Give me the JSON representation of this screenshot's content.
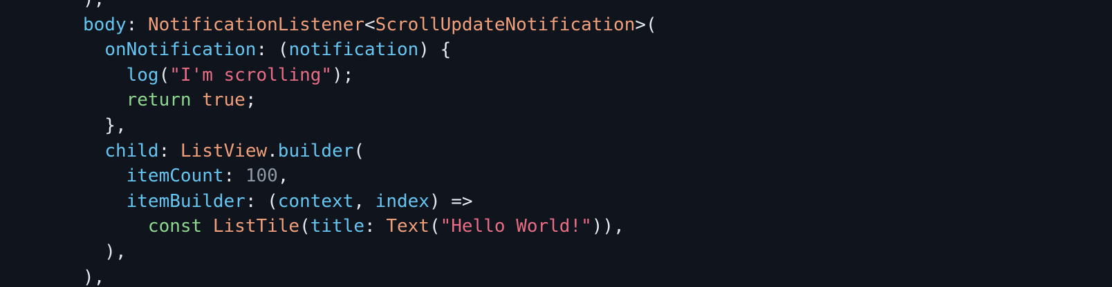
{
  "editor": {
    "background": "#0f141d",
    "colors": {
      "plain": "#e6e9ef",
      "property": "#66c6f1",
      "type": "#f2a07b",
      "string": "#e86d85",
      "keyword": "#8ed88f",
      "number": "#9099a6"
    },
    "lines": [
      [
        {
          "t": "),",
          "k": "plain"
        }
      ],
      [
        {
          "t": "body",
          "k": "prop"
        },
        {
          "t": ": ",
          "k": "plain"
        },
        {
          "t": "NotificationListener",
          "k": "type"
        },
        {
          "t": "<",
          "k": "plain"
        },
        {
          "t": "ScrollUpdateNotification",
          "k": "type"
        },
        {
          "t": ">(",
          "k": "plain"
        }
      ],
      [
        {
          "t": "  ",
          "k": "plain"
        },
        {
          "t": "onNotification",
          "k": "prop"
        },
        {
          "t": ": (",
          "k": "plain"
        },
        {
          "t": "notification",
          "k": "param"
        },
        {
          "t": ") {",
          "k": "plain"
        }
      ],
      [
        {
          "t": "    ",
          "k": "plain"
        },
        {
          "t": "log",
          "k": "func"
        },
        {
          "t": "(",
          "k": "plain"
        },
        {
          "t": "\"I'm scrolling\"",
          "k": "string"
        },
        {
          "t": ");",
          "k": "plain"
        }
      ],
      [
        {
          "t": "    ",
          "k": "plain"
        },
        {
          "t": "return",
          "k": "keyword"
        },
        {
          "t": " ",
          "k": "plain"
        },
        {
          "t": "true",
          "k": "bool"
        },
        {
          "t": ";",
          "k": "plain"
        }
      ],
      [
        {
          "t": "  },",
          "k": "plain"
        }
      ],
      [
        {
          "t": "  ",
          "k": "plain"
        },
        {
          "t": "child",
          "k": "prop"
        },
        {
          "t": ": ",
          "k": "plain"
        },
        {
          "t": "ListView",
          "k": "type"
        },
        {
          "t": ".",
          "k": "plain"
        },
        {
          "t": "builder",
          "k": "func"
        },
        {
          "t": "(",
          "k": "plain"
        }
      ],
      [
        {
          "t": "    ",
          "k": "plain"
        },
        {
          "t": "itemCount",
          "k": "prop"
        },
        {
          "t": ": ",
          "k": "plain"
        },
        {
          "t": "100",
          "k": "number"
        },
        {
          "t": ",",
          "k": "plain"
        }
      ],
      [
        {
          "t": "    ",
          "k": "plain"
        },
        {
          "t": "itemBuilder",
          "k": "prop"
        },
        {
          "t": ": (",
          "k": "plain"
        },
        {
          "t": "context",
          "k": "param"
        },
        {
          "t": ", ",
          "k": "plain"
        },
        {
          "t": "index",
          "k": "param"
        },
        {
          "t": ") =>",
          "k": "plain"
        }
      ],
      [
        {
          "t": "      ",
          "k": "plain"
        },
        {
          "t": "const",
          "k": "keyword"
        },
        {
          "t": " ",
          "k": "plain"
        },
        {
          "t": "ListTile",
          "k": "type"
        },
        {
          "t": "(",
          "k": "plain"
        },
        {
          "t": "title",
          "k": "prop"
        },
        {
          "t": ": ",
          "k": "plain"
        },
        {
          "t": "Text",
          "k": "type"
        },
        {
          "t": "(",
          "k": "plain"
        },
        {
          "t": "\"Hello World!\"",
          "k": "string"
        },
        {
          "t": ")),",
          "k": "plain"
        }
      ],
      [
        {
          "t": "  ),",
          "k": "plain"
        }
      ],
      [
        {
          "t": "),",
          "k": "plain"
        }
      ]
    ]
  }
}
